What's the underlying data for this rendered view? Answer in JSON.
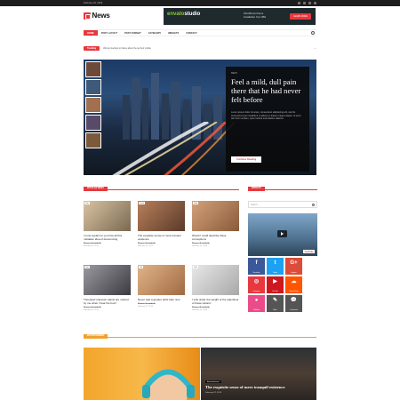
{
  "topbar": {
    "date": "February 22, 2019"
  },
  "logo": {
    "text": "News"
  },
  "banner": {
    "brand_left": "envato",
    "brand_right": "studio",
    "line1": "WordPress theme",
    "line2": "installation from $50",
    "cta": "LEARN MORE"
  },
  "nav": {
    "items": [
      {
        "label": "Home"
      },
      {
        "label": "Post Layout"
      },
      {
        "label": "Post Format"
      },
      {
        "label": "Category"
      },
      {
        "label": "Widgets"
      },
      {
        "label": "Contact"
      }
    ]
  },
  "ticker": {
    "label": "Trending",
    "text": "Woman feelings to blame about the as their mobile",
    "arrows": "‹ ›"
  },
  "hero": {
    "category": "Tech",
    "title": "Feel a mild, dull pain there that he had never felt before",
    "excerpt": "Lorem ipsum dolor sit amet, consectetur adipisicing elit, sed do eiusmod tempor incididunt ut labore et dolore magna aliqua. Ut enim ad minim veniam, quis nostrud exercitation ullamco.",
    "button": "Continue Reading"
  },
  "popular": {
    "label": "Popular News",
    "cards": [
      {
        "title": "I must explain to you how all this mistaken idea of denouncing",
        "author": "Simone Arrivabello",
        "date": "February 22, 2019",
        "category": "Tech"
      },
      {
        "title": "The exquisite sense of mere tranquil existence",
        "author": "Simone Arrivabello",
        "date": "February 22, 2019",
        "category": "Travel"
      },
      {
        "title": "Would I could describe these conceptions",
        "author": "Simone Arrivabello",
        "date": "February 22, 2019",
        "category": "Food"
      },
      {
        "title": "Thousand unknown plants are noticed by me when I hear the buzz",
        "author": "Simone Arrivabello",
        "date": "February 22, 2019",
        "category": "Tech"
      },
      {
        "title": "Never was a greater artist than now",
        "author": "Simone Arrivabello",
        "date": "February 22, 2019",
        "category": "Life"
      },
      {
        "title": "I sink under the weight of the splendour of these visions!",
        "author": "Simone Arrivabello",
        "date": "February 22, 2019",
        "category": "Tech"
      }
    ]
  },
  "sidebar": {
    "label": "Widgets",
    "search_placeholder": "Search ...",
    "video_badge": "YouTube"
  },
  "social": {
    "tiles": [
      {
        "icon": "f",
        "name": "Facebook",
        "color": "#3b5998"
      },
      {
        "icon": "t",
        "name": "Twitter",
        "color": "#1da1f2"
      },
      {
        "icon": "G+",
        "name": "Google+",
        "color": "#dd4b39"
      },
      {
        "icon": "◎",
        "name": "Instagram",
        "color": "#e8383d"
      },
      {
        "icon": "▶",
        "name": "YouTube",
        "color": "#cc181e"
      },
      {
        "icon": "☁",
        "name": "SoundCloud",
        "color": "#ff5500"
      },
      {
        "icon": "●",
        "name": "Dribbble",
        "color": "#ea4c89"
      },
      {
        "icon": "✎",
        "name": "Write",
        "color": "#555"
      },
      {
        "icon": "💬",
        "name": "Comments",
        "color": "#555"
      }
    ]
  },
  "entertainment": {
    "label": "Entertainment",
    "right": {
      "category": "Entertainment",
      "title": "The exquisite sense of mere tranquil existence",
      "date": "February 22, 2019"
    }
  }
}
